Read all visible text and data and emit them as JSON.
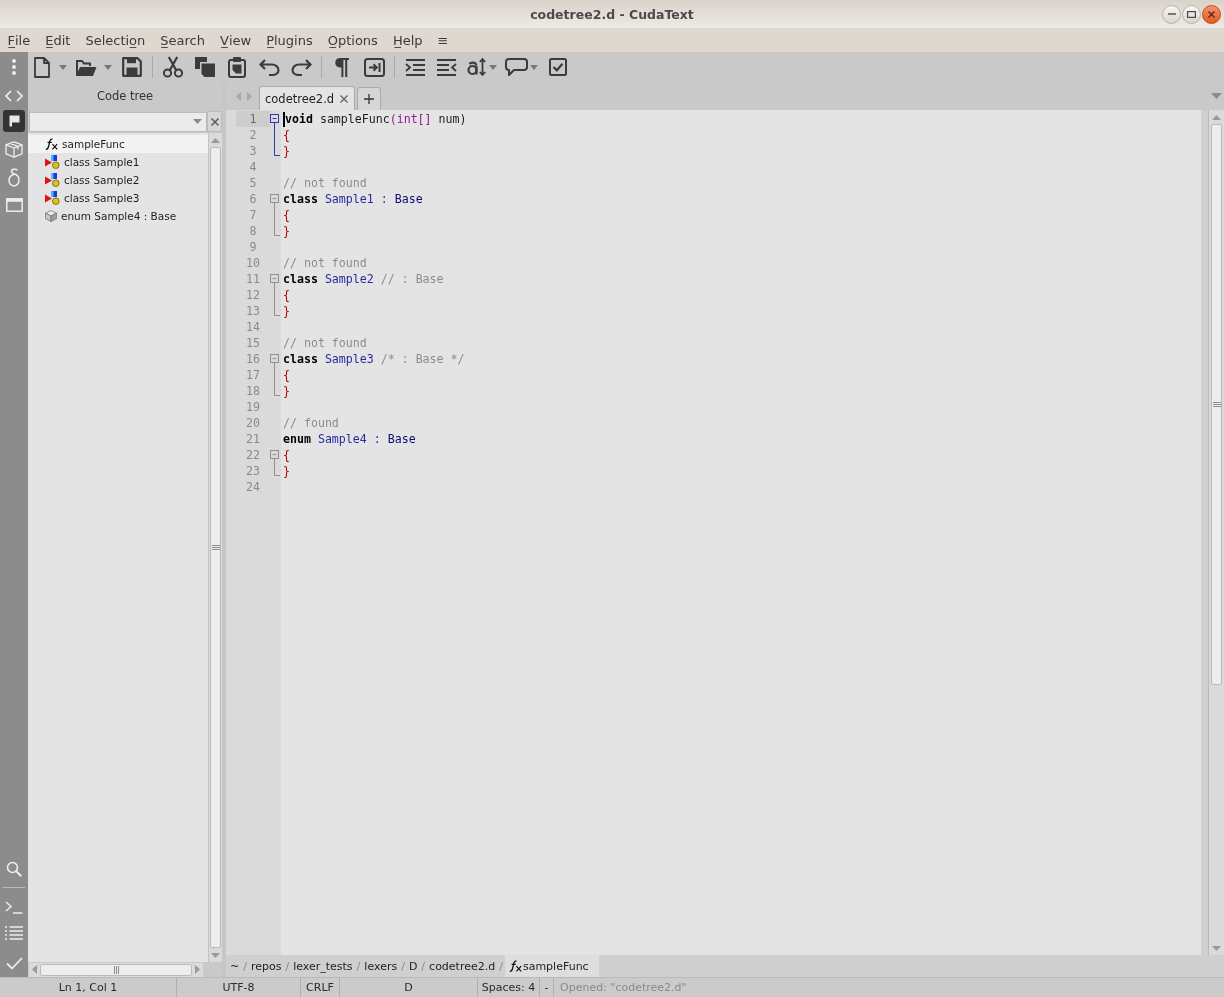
{
  "window": {
    "title": "codetree2.d - CudaText"
  },
  "menu": [
    {
      "label": "F̲ile"
    },
    {
      "label": "E̲dit"
    },
    {
      "label": "Selectio̲n"
    },
    {
      "label": "S̲earch"
    },
    {
      "label": "V̲iew"
    },
    {
      "label": "P̲lugins"
    },
    {
      "label": "O̲ptions"
    },
    {
      "label": "H̲elp"
    },
    {
      "label": "≡"
    }
  ],
  "sidebar": {
    "buttons": [
      {
        "selected": true
      },
      {
        "selected": false
      },
      {
        "selected": false
      },
      {
        "selected": false
      }
    ]
  },
  "code_tree": {
    "title": "Code tree",
    "items": [
      {
        "label": "sampleFunc",
        "kind": "function",
        "selected": true
      },
      {
        "label": "class Sample1",
        "kind": "class",
        "selected": false
      },
      {
        "label": "class Sample2",
        "kind": "class",
        "selected": false
      },
      {
        "label": "class Sample3",
        "kind": "class",
        "selected": false
      },
      {
        "label": "enum Sample4 : Base",
        "kind": "enum",
        "selected": false
      }
    ]
  },
  "tabs": [
    {
      "label": "codetree2.d",
      "selected": true
    }
  ],
  "editor": {
    "lines": [
      {
        "number": "1",
        "current": true,
        "fold": {
          "kind": "open",
          "active": true
        },
        "tokens": [
          {
            "text": "void",
            "kind": "keyword"
          },
          {
            "text": " sampleFunc",
            "kind": "plain"
          },
          {
            "text": "(int[]",
            "kind": "type"
          },
          {
            "text": " num)",
            "kind": "plain"
          }
        ]
      },
      {
        "number": "2",
        "current": false,
        "fold": {
          "kind": "inside"
        },
        "tokens": [
          {
            "text": "{",
            "kind": "brace"
          }
        ]
      },
      {
        "number": "3",
        "current": false,
        "fold": {
          "kind": "end"
        },
        "tokens": [
          {
            "text": "}",
            "kind": "brace"
          }
        ]
      },
      {
        "number": "4",
        "current": false
      },
      {
        "number": "5",
        "current": false,
        "tokens": [
          {
            "text": "// not found",
            "kind": "comment"
          }
        ]
      },
      {
        "number": "6",
        "current": false,
        "fold": {
          "kind": "open",
          "active": false
        },
        "tokens": [
          {
            "text": "class",
            "kind": "keyword"
          },
          {
            "text": " Sample1 : ",
            "kind": "ident"
          },
          {
            "text": "Base",
            "kind": "base"
          }
        ]
      },
      {
        "number": "7",
        "current": false,
        "fold": {
          "kind": "inside"
        },
        "tokens": [
          {
            "text": "{",
            "kind": "brace"
          }
        ]
      },
      {
        "number": "8",
        "current": false,
        "fold": {
          "kind": "end"
        },
        "tokens": [
          {
            "text": "}",
            "kind": "brace"
          }
        ]
      },
      {
        "number": "9",
        "current": false
      },
      {
        "number": "10",
        "current": false,
        "tokens": [
          {
            "text": "// not found",
            "kind": "comment"
          }
        ]
      },
      {
        "number": "11",
        "current": false,
        "fold": {
          "kind": "open",
          "active": false
        },
        "tokens": [
          {
            "text": "class",
            "kind": "keyword"
          },
          {
            "text": " Sample2",
            "kind": "ident"
          },
          {
            "text": " // : Base",
            "kind": "comment"
          }
        ]
      },
      {
        "number": "12",
        "current": false,
        "fold": {
          "kind": "inside"
        },
        "tokens": [
          {
            "text": "{",
            "kind": "brace"
          }
        ]
      },
      {
        "number": "13",
        "current": false,
        "fold": {
          "kind": "end"
        },
        "tokens": [
          {
            "text": "}",
            "kind": "brace"
          }
        ]
      },
      {
        "number": "14",
        "current": false
      },
      {
        "number": "15",
        "current": false,
        "tokens": [
          {
            "text": "// not found",
            "kind": "comment"
          }
        ]
      },
      {
        "number": "16",
        "current": false,
        "fold": {
          "kind": "open",
          "active": false
        },
        "tokens": [
          {
            "text": "class",
            "kind": "keyword"
          },
          {
            "text": " Sample3",
            "kind": "ident"
          },
          {
            "text": " /* : Base */",
            "kind": "comment"
          }
        ]
      },
      {
        "number": "17",
        "current": false,
        "fold": {
          "kind": "inside"
        },
        "tokens": [
          {
            "text": "{",
            "kind": "brace"
          }
        ]
      },
      {
        "number": "18",
        "current": false,
        "fold": {
          "kind": "end"
        },
        "tokens": [
          {
            "text": "}",
            "kind": "brace"
          }
        ]
      },
      {
        "number": "19",
        "current": false
      },
      {
        "number": "20",
        "current": false,
        "tokens": [
          {
            "text": "// found",
            "kind": "comment"
          }
        ]
      },
      {
        "number": "21",
        "current": false,
        "tokens": [
          {
            "text": "enum",
            "kind": "keyword"
          },
          {
            "text": " Sample4 : ",
            "kind": "ident"
          },
          {
            "text": "Base",
            "kind": "base"
          }
        ]
      },
      {
        "number": "22",
        "current": false,
        "fold": {
          "kind": "open",
          "active": false
        },
        "tokens": [
          {
            "text": "{",
            "kind": "brace"
          }
        ]
      },
      {
        "number": "23",
        "current": false,
        "fold": {
          "kind": "end"
        },
        "tokens": [
          {
            "text": "}",
            "kind": "brace"
          }
        ]
      },
      {
        "number": "24",
        "current": false
      }
    ]
  },
  "breadcrumb": [
    {
      "kind": "segment",
      "label": "~"
    },
    {
      "kind": "separator",
      "label": "/"
    },
    {
      "kind": "segment",
      "label": "repos"
    },
    {
      "kind": "separator",
      "label": "/"
    },
    {
      "kind": "segment",
      "label": "lexer_tests"
    },
    {
      "kind": "separator",
      "label": "/"
    },
    {
      "kind": "segment",
      "label": "lexers"
    },
    {
      "kind": "separator",
      "label": "/"
    },
    {
      "kind": "segment",
      "label": "D"
    },
    {
      "kind": "separator",
      "label": "/"
    },
    {
      "kind": "segment",
      "label": "codetree2.d"
    },
    {
      "kind": "separator",
      "label": "/"
    },
    {
      "kind": "symbol",
      "label": "sampleFunc"
    }
  ],
  "status_bar": [
    {
      "kind": "field",
      "text": "Ln 1, Col 1"
    },
    {
      "kind": "field",
      "text": "UTF-8"
    },
    {
      "kind": "field",
      "text": "CRLF"
    },
    {
      "kind": "field",
      "text": "D"
    },
    {
      "kind": "field",
      "text": "Spaces: 4"
    },
    {
      "kind": "field",
      "text": "-"
    },
    {
      "kind": "message",
      "text": "Opened: \"codetree2.d\""
    }
  ]
}
